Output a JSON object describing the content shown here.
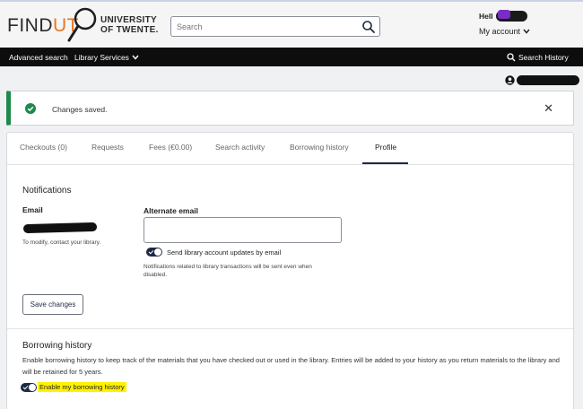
{
  "header": {
    "logo_find": "FIND",
    "logo_ut": "UT",
    "university_line1": "UNIVERSITY",
    "university_line2": "OF TWENTE.",
    "search_placeholder": "Search",
    "hello": "Hell",
    "my_account": "My account"
  },
  "nav": {
    "advanced_search": "Advanced search",
    "library_services": "Library Services",
    "search_history": "Search History"
  },
  "alert": {
    "message": "Changes saved.",
    "close": "✕"
  },
  "tabs": [
    {
      "label": "Checkouts (0)"
    },
    {
      "label": "Requests"
    },
    {
      "label": "Fees (€0.00)"
    },
    {
      "label": "Search activity"
    },
    {
      "label": "Borrowing history"
    },
    {
      "label": "Profile"
    }
  ],
  "notifications": {
    "title": "Notifications",
    "email_label": "Email",
    "email_note": "To modify, contact your library.",
    "alternate_email_label": "Alternate email",
    "alternate_email_value": "",
    "toggle_label": "Send library account updates by email",
    "toggle_note": "Notifications related to library transactions will be sent even when disabled.",
    "save_button": "Save changes"
  },
  "borrowing_history": {
    "title": "Borrowing history",
    "description": "Enable borrowing history to keep track of the materials that you have checked out or used in the library. Entries will be added to your history as you return materials to the library and will be retained for 5 years.",
    "toggle_label": "Enable my borrowing history"
  },
  "colors": {
    "accent_orange": "#e87722",
    "nav_bg": "#0d0d0d",
    "success_green": "#1d8a4c",
    "toggle_navy": "#1e2a44",
    "highlight": "#fff200"
  }
}
